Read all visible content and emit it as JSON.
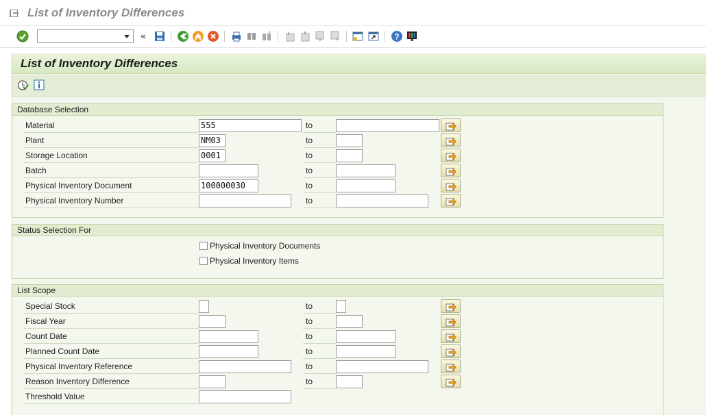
{
  "window": {
    "title": "List of Inventory Differences"
  },
  "program": {
    "title": "List of Inventory Differences"
  },
  "range_to": "to",
  "groups": {
    "database": {
      "title": "Database Selection",
      "rows": [
        {
          "label": "Material",
          "from": "555",
          "to": ""
        },
        {
          "label": "Plant",
          "from": "NM03",
          "to": ""
        },
        {
          "label": "Storage Location",
          "from": "0001",
          "to": ""
        },
        {
          "label": "Batch",
          "from": "",
          "to": ""
        },
        {
          "label": "Physical Inventory Document",
          "from": "100000030",
          "to": ""
        },
        {
          "label": "Physical Inventory Number",
          "from": "",
          "to": ""
        }
      ]
    },
    "status": {
      "title": "Status Selection For",
      "checkboxes": [
        {
          "label": "Physical Inventory Documents",
          "checked": false
        },
        {
          "label": "Physical Inventory Items",
          "checked": false
        }
      ]
    },
    "scope": {
      "title": "List Scope",
      "rows": [
        {
          "label": "Special Stock",
          "from": "",
          "to": ""
        },
        {
          "label": "Fiscal Year",
          "from": "",
          "to": ""
        },
        {
          "label": "Count Date",
          "from": "",
          "to": ""
        },
        {
          "label": "Planned Count Date",
          "from": "",
          "to": ""
        },
        {
          "label": "Physical Inventory Reference",
          "from": "",
          "to": ""
        },
        {
          "label": "Reason Inventory Difference",
          "from": "",
          "to": ""
        },
        {
          "label": "Threshold Value",
          "from": ""
        }
      ]
    }
  },
  "toolbar": {
    "command_field": "",
    "collapse_glyph": "«",
    "icons": [
      "enter-icon",
      "save-icon",
      "back-icon",
      "exit-icon",
      "cancel-icon",
      "print-icon",
      "find-icon",
      "find-next-icon",
      "first-page-icon",
      "previous-page-icon",
      "next-page-icon",
      "last-page-icon",
      "new-session-icon",
      "shortcut-icon",
      "help-icon",
      "customize-layout-icon"
    ]
  },
  "app_toolbar": {
    "icons": [
      "execute-icon",
      "info-icon"
    ]
  },
  "colors": {
    "header_green": "#d7e8c1",
    "background": "#f2f6ec",
    "group_border": "#c3d4a8"
  }
}
